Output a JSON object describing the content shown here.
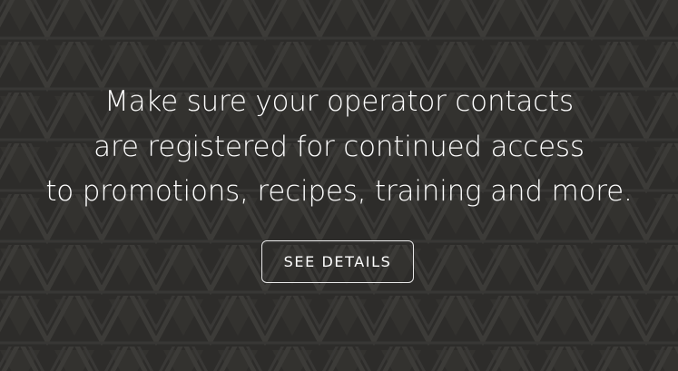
{
  "banner": {
    "headline_lines": [
      "Make sure your operator contacts",
      "are registered for continued access",
      "to promotions, recipes, training and more."
    ],
    "cta_label": "SEE DETAILS"
  },
  "colors": {
    "background": "#2d2c2a",
    "pattern": "#3b3a38",
    "text": "#ffffff"
  }
}
